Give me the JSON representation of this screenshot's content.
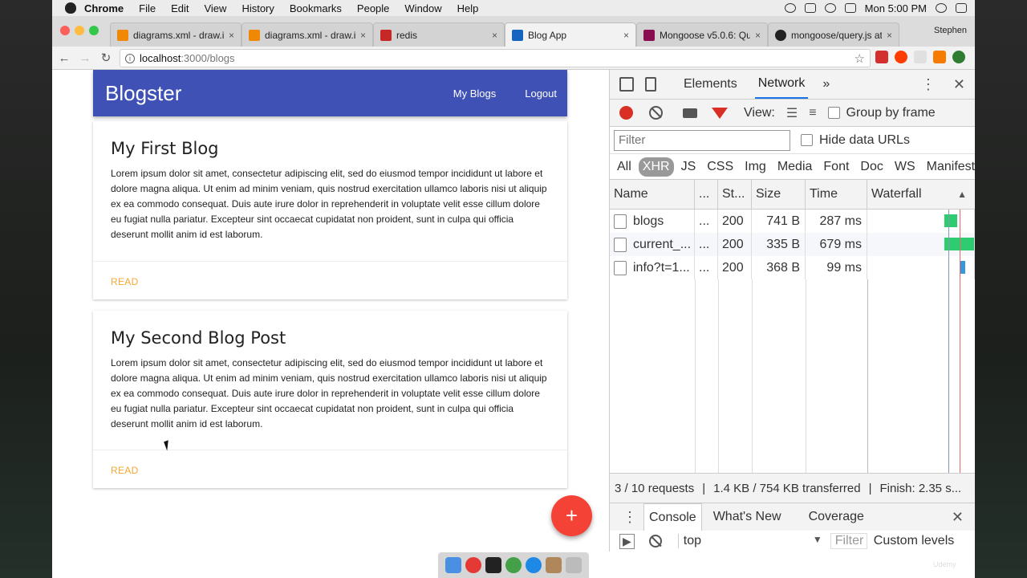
{
  "menubar": {
    "items": [
      "Chrome",
      "File",
      "Edit",
      "View",
      "History",
      "Bookmarks",
      "People",
      "Window",
      "Help"
    ],
    "clock": "Mon 5:00 PM"
  },
  "tabs": [
    {
      "label": "diagrams.xml - draw.io",
      "color": "#f08705"
    },
    {
      "label": "diagrams.xml - draw.io",
      "color": "#f08705"
    },
    {
      "label": "redis",
      "color": "#c62828"
    },
    {
      "label": "Blog App",
      "color": "#1565c0"
    },
    {
      "label": "Mongoose v5.0.6: Que",
      "color": "#880e4f"
    },
    {
      "label": "mongoose/query.js at",
      "color": "#222222"
    }
  ],
  "profile": "Stephen",
  "address": {
    "host": "localhost",
    "path": ":3000/blogs"
  },
  "app": {
    "brand": "Blogster",
    "nav": [
      "My Blogs",
      "Logout"
    ],
    "posts": [
      {
        "title": "My First Blog",
        "body": "Lorem ipsum dolor sit amet, consectetur adipiscing elit, sed do eiusmod tempor incididunt ut labore et dolore magna aliqua. Ut enim ad minim veniam, quis nostrud exercitation ullamco laboris nisi ut aliquip ex ea commodo consequat. Duis aute irure dolor in reprehenderit in voluptate velit esse cillum dolore eu fugiat nulla pariatur. Excepteur sint occaecat cupidatat non proident, sunt in culpa qui officia deserunt mollit anim id est laborum.",
        "action": "READ"
      },
      {
        "title": "My Second Blog Post",
        "body": "Lorem ipsum dolor sit amet, consectetur adipiscing elit, sed do eiusmod tempor incididunt ut labore et dolore magna aliqua. Ut enim ad minim veniam, quis nostrud exercitation ullamco laboris nisi ut aliquip ex ea commodo consequat. Duis aute irure dolor in reprehenderit in voluptate velit esse cillum dolore eu fugiat nulla pariatur. Excepteur sint occaecat cupidatat non proident, sunt in culpa qui officia deserunt mollit anim id est laborum.",
        "action": "READ"
      }
    ],
    "fab": "+"
  },
  "devtools": {
    "tabs": [
      "Elements",
      "Network"
    ],
    "more": "»",
    "view_label": "View:",
    "group_by_frame": "Group by frame",
    "filter_placeholder": "Filter",
    "hide_data_urls": "Hide data URLs",
    "types": [
      "All",
      "XHR",
      "JS",
      "CSS",
      "Img",
      "Media",
      "Font",
      "Doc",
      "WS",
      "Manifest"
    ],
    "columns": {
      "name": "Name",
      "dots": "...",
      "status": "St...",
      "size": "Size",
      "time": "Time",
      "waterfall": "Waterfall"
    },
    "requests": [
      {
        "name": "blogs",
        "dots": "...",
        "status": "200",
        "size": "741 B",
        "time": "287 ms"
      },
      {
        "name": "current_...",
        "dots": "...",
        "status": "200",
        "size": "335 B",
        "time": "679 ms"
      },
      {
        "name": "info?t=1...",
        "dots": "...",
        "status": "200",
        "size": "368 B",
        "time": "99 ms"
      }
    ],
    "status": {
      "requests": "3 / 10 requests",
      "transferred": "1.4 KB / 754 KB transferred",
      "finish": "Finish: 2.35 s..."
    },
    "drawer_tabs": [
      "Console",
      "What's New",
      "Coverage"
    ],
    "console_context": "top",
    "console_filter": "Filter",
    "console_levels": "Custom levels"
  },
  "watermark": "Udemy"
}
